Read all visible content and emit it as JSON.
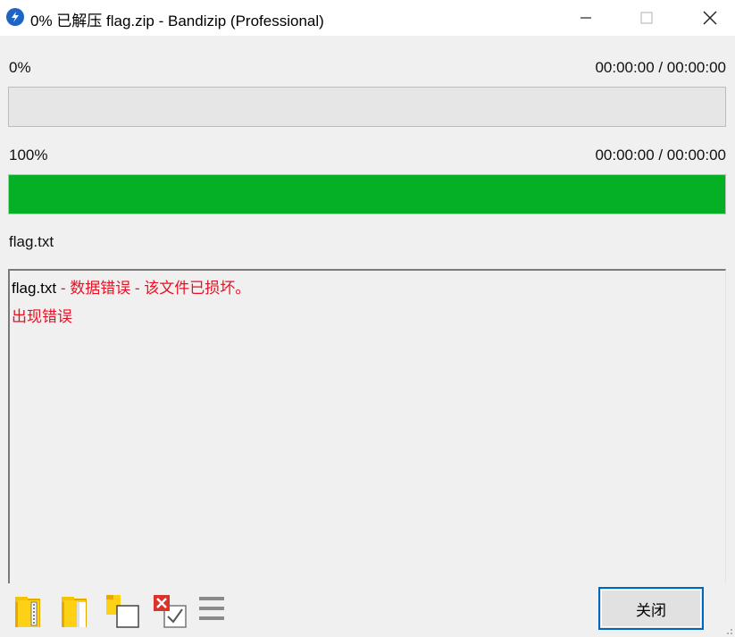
{
  "window": {
    "title": "0% 已解压 flag.zip - Bandizip (Professional)",
    "app_icon": "bandizip-icon",
    "controls": [
      "minimize-icon",
      "maximize-icon",
      "close-icon"
    ]
  },
  "current_progress": {
    "percent_label": "0%",
    "time": "00:00:00 / 00:00:00",
    "fraction": 0
  },
  "total_progress": {
    "percent_label": "100%",
    "time": "00:00:00 / 00:00:00",
    "fraction": 1.0
  },
  "current_file": "flag.txt",
  "log": {
    "line1_file": "flag.txt",
    "line1_message": " - 数据错误 - 该文件已损坏。",
    "line2": "出现错误"
  },
  "toolbar": {
    "icons": [
      "archive-folder-icon",
      "open-folder-icon",
      "copy-window-icon",
      "error-check-icon",
      "menu-icon"
    ]
  },
  "close_button": {
    "label": "关闭"
  },
  "colors": {
    "progress_fill": "#06b025",
    "error_text": "#e81123",
    "accent": "#0067c0",
    "app_icon": "#1d64c4"
  }
}
